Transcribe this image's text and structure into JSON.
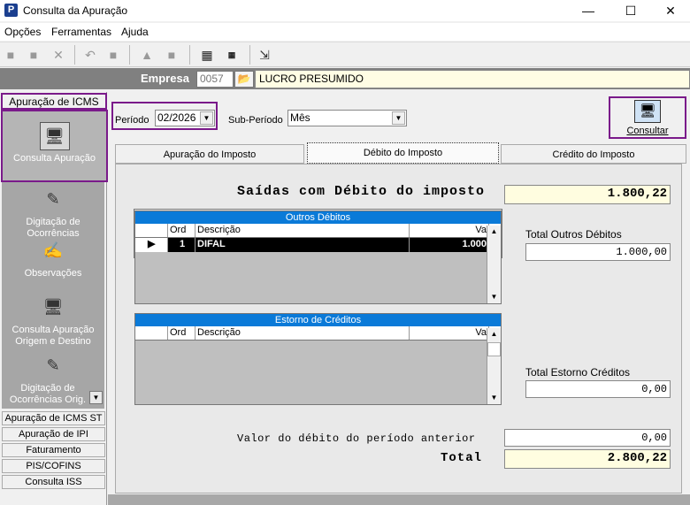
{
  "window": {
    "title": "Consulta da Apuração",
    "minimize": "—",
    "maximize": "☐",
    "close": "✕",
    "app_icon": "P"
  },
  "menu": {
    "items": [
      "Opções",
      "Ferramentas",
      "Ajuda"
    ]
  },
  "empresa": {
    "label": "Empresa",
    "code": "0057",
    "name": "LUCRO PRESUMIDO"
  },
  "sidebar": {
    "header": "Apuração de ICMS",
    "items": [
      {
        "label": "Consulta Apuração",
        "icon": "monitor-icon"
      },
      {
        "label": "Digitação de Ocorrências",
        "icon": "pencil-icon"
      },
      {
        "label": "Observações",
        "icon": "notes-icon"
      },
      {
        "label": "Consulta Apuração Origem e Destino",
        "icon": "difal-monitor-icon"
      },
      {
        "label": "Digitação de Ocorrências Orig. De",
        "icon": "difal-pencil-icon"
      }
    ],
    "buttons": [
      "Apuração de ICMS ST",
      "Apuração de IPI",
      "Faturamento",
      "PIS/COFINS",
      "Consulta ISS"
    ]
  },
  "filters": {
    "periodo_label": "Período",
    "periodo_value": "02/2026",
    "subperiodo_label": "Sub-Período",
    "subperiodo_value": "Mês"
  },
  "consultar_label": "Consultar",
  "tabs": [
    "Apuração do Imposto",
    "Débito do Imposto",
    "Crédito do Imposto"
  ],
  "active_tab": "Débito do Imposto",
  "debito": {
    "saidas_label": "Saídas com Débito do imposto",
    "saidas_value": "1.800,22",
    "outros_debitos": {
      "title": "Outros Débitos",
      "columns": [
        "Ord",
        "Descrição",
        "Va"
      ],
      "rows": [
        {
          "ord": "1",
          "descricao": "DIFAL",
          "valor": "1.000"
        }
      ]
    },
    "total_outros_label": "Total Outros Débitos",
    "total_outros_value": "1.000,00",
    "estorno_creditos": {
      "title": "Estorno de Créditos",
      "columns": [
        "Ord",
        "Descrição",
        "Va"
      ]
    },
    "total_estorno_label": "Total Estorno Créditos",
    "total_estorno_value": "0,00",
    "periodo_anterior_label": "Valor do débito do período anterior",
    "periodo_anterior_value": "0,00",
    "total_label": "Total",
    "total_value": "2.800,22"
  }
}
